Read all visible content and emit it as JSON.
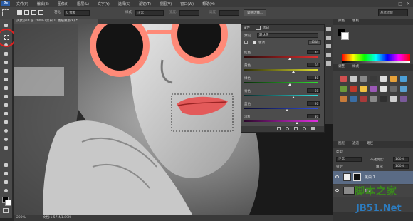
{
  "app": {
    "logo": "Ps",
    "menu": [
      "文件(F)",
      "编辑(E)",
      "图像(I)",
      "图层(L)",
      "文字(Y)",
      "选择(S)",
      "滤镜(T)",
      "视图(V)",
      "窗口(W)",
      "帮助(H)"
    ],
    "window_controls": [
      "–",
      "□",
      "✕"
    ]
  },
  "options_bar": {
    "feather_label": "羽化:",
    "feather_value": "0 像素",
    "style_label": "样式:",
    "style_value": "正常",
    "width_label": "宽度:",
    "height_label": "高度:",
    "refine_button": "调整边缘...",
    "workspace": "基本功能"
  },
  "document": {
    "tab_title": "美女.psd @ 200% (黑白 1, 图层蒙版/8) *",
    "zoom": "200%",
    "doc_info": "文档:1.57M/1.89M"
  },
  "properties": {
    "panel_tabs": [
      "属性",
      "黑白"
    ],
    "preset_label": "预设:",
    "preset_value": "默认值",
    "tint_label": "色调",
    "auto_button": "自动",
    "sliders": [
      {
        "label": "红色:",
        "value": "40",
        "pos": 0.62,
        "gradient": [
          "#2a0808",
          "#e03030"
        ]
      },
      {
        "label": "黄色:",
        "value": "60",
        "pos": 0.66,
        "gradient": [
          "#2a2a08",
          "#e0e030"
        ]
      },
      {
        "label": "绿色:",
        "value": "40",
        "pos": 0.62,
        "gradient": [
          "#082a08",
          "#30e030"
        ]
      },
      {
        "label": "青色:",
        "value": "60",
        "pos": 0.66,
        "gradient": [
          "#082a2a",
          "#30e0e0"
        ]
      },
      {
        "label": "蓝色:",
        "value": "20",
        "pos": 0.58,
        "gradient": [
          "#08082a",
          "#3050e0"
        ]
      },
      {
        "label": "洋红:",
        "value": "80",
        "pos": 0.71,
        "gradient": [
          "#2a082a",
          "#e030e0"
        ]
      }
    ]
  },
  "dock": {
    "color_tabs": [
      "颜色",
      "色板"
    ],
    "adjust_tabs": [
      "调整",
      "样式"
    ],
    "layer_tabs": [
      "图层",
      "通道",
      "路径"
    ],
    "kind_label": "类型",
    "blend_mode": "正常",
    "opacity_label": "不透明度:",
    "opacity_value": "100%",
    "lock_label": "锁定:",
    "fill_label": "填充:",
    "fill_value": "100%",
    "layers": [
      {
        "name": "黑白 1",
        "selected": true
      },
      {
        "name": "背景",
        "selected": false
      }
    ]
  },
  "watermark": {
    "line1": "脚本之家",
    "line2": "JB51.Net"
  }
}
